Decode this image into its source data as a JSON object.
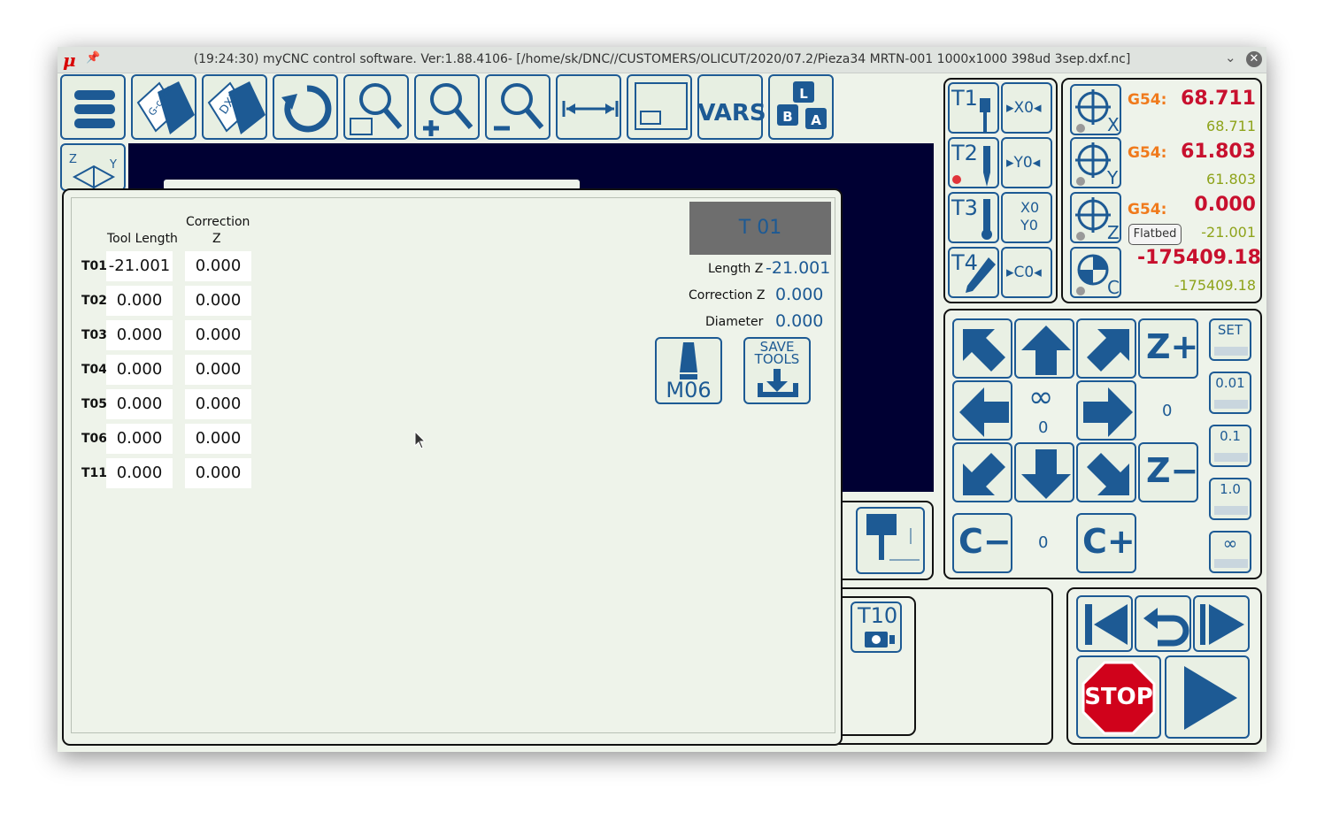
{
  "window": {
    "title": "(19:24:30) myCNC control software. Ver:1.88.4106- [/home/sk/DNC//CUSTOMERS/OLICUT/2020/07.2/Pieza34 MRTN-001 1000x1000 398ud 3sep.dxf.nc]",
    "logo": "μ",
    "pin": "📌",
    "chevron": "⌄",
    "close": "✕"
  },
  "toolbar": {
    "gcode_label": "G-code",
    "dxf_label": "DXF",
    "vars_label": "VARS",
    "layers_labels": [
      "L",
      "B",
      "A"
    ]
  },
  "view_icon": {
    "z": "Z",
    "y": "Y"
  },
  "tool_table": {
    "header_tool_length": "Tool Length",
    "header_correction": "Correction",
    "header_z": "Z",
    "rows": [
      {
        "tool": "T01",
        "length": "-21.001",
        "correction": "0.000"
      },
      {
        "tool": "T02",
        "length": "0.000",
        "correction": "0.000"
      },
      {
        "tool": "T03",
        "length": "0.000",
        "correction": "0.000"
      },
      {
        "tool": "T04",
        "length": "0.000",
        "correction": "0.000"
      },
      {
        "tool": "T05",
        "length": "0.000",
        "correction": "0.000"
      },
      {
        "tool": "T06",
        "length": "0.000",
        "correction": "0.000"
      },
      {
        "tool": "T11",
        "length": "0.000",
        "correction": "0.000"
      }
    ]
  },
  "tool_info": {
    "current_tool": "T 01",
    "length_label": "Length Z",
    "length_value": "-21.001",
    "correction_label": "Correction Z",
    "correction_value": "0.000",
    "diameter_label": "Diameter",
    "diameter_value": "0.000",
    "m06_label": "M06",
    "save_line1": "SAVE",
    "save_line2": "TOOLS"
  },
  "tools_panel": {
    "t1": "T1",
    "t2": "T2",
    "t3": "T3",
    "t4": "T4",
    "x0": "▸X0◂",
    "y0": "▸Y0◂",
    "x0y0_top": "X0",
    "x0y0_bottom": "Y0",
    "c0": "▸C0◂"
  },
  "coords": {
    "x": {
      "wcs": "G54:",
      "value": "68.711",
      "machine": "68.711",
      "axis": "X"
    },
    "y": {
      "wcs": "G54:",
      "value": "61.803",
      "machine": "61.803",
      "axis": "Y"
    },
    "z": {
      "wcs": "G54:",
      "value": "0.000",
      "machine": "-21.001",
      "axis": "Z"
    },
    "c": {
      "value": "-175409.18",
      "machine": "-175409.18",
      "axis": "C"
    },
    "flatbed_label": "Flatbed"
  },
  "jog": {
    "z_plus": "Z+",
    "z_minus": "Z−",
    "c_minus": "C−",
    "c_plus": "C+",
    "infinity": "∞",
    "xy_step": "0",
    "z_step": "0",
    "c_step": "0",
    "steps": [
      "SET",
      "0.01",
      "0.1",
      "1.0",
      "∞"
    ]
  },
  "t10_label": "T10",
  "stop_label": "STOP",
  "colors": {
    "accent": "#1d5a94",
    "value_red": "#c8102e",
    "machine_olive": "#8ea31a",
    "wcs_orange": "#f07a1c",
    "viewport": "#000033"
  }
}
